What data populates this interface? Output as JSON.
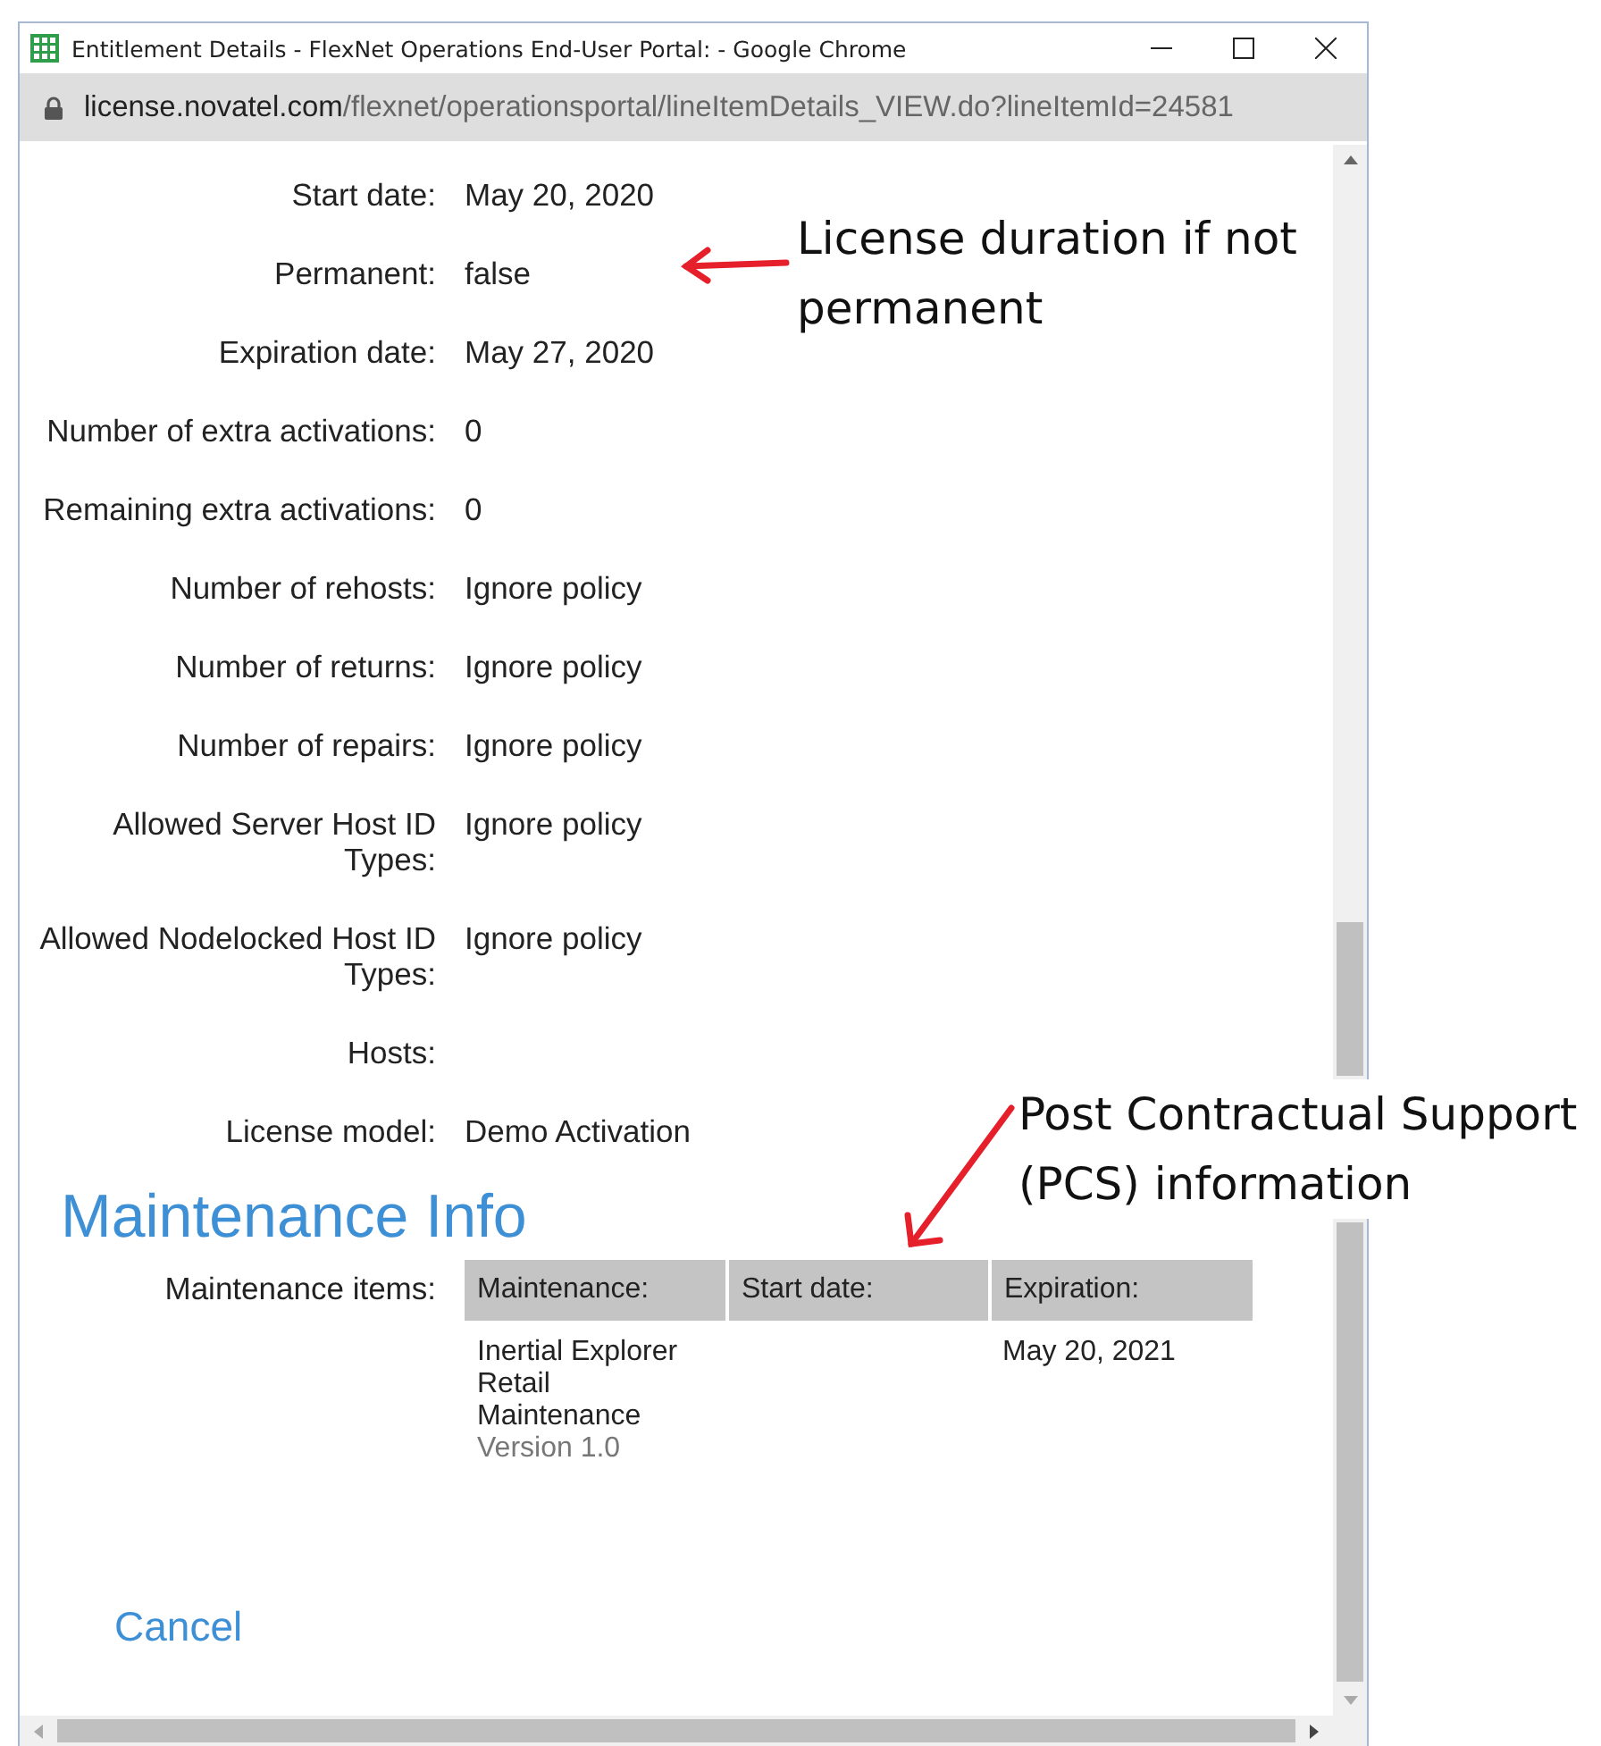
{
  "window": {
    "title": "Entitlement Details - FlexNet Operations End-User Portal: - Google Chrome",
    "url_host": "license.novatel.com",
    "url_path": "/flexnet/operationsportal/lineItemDetails_VIEW.do?lineItemId=24581"
  },
  "fields": [
    {
      "label": "Start date:",
      "value": "May 20, 2020"
    },
    {
      "label": "Permanent:",
      "value": "false"
    },
    {
      "label": "Expiration date:",
      "value": "May 27, 2020"
    },
    {
      "label": "Number of extra activations:",
      "value": "0"
    },
    {
      "label": "Remaining extra activations:",
      "value": "0"
    },
    {
      "label": "Number of rehosts:",
      "value": "Ignore policy"
    },
    {
      "label": "Number of returns:",
      "value": "Ignore policy"
    },
    {
      "label": "Number of repairs:",
      "value": "Ignore policy"
    },
    {
      "label": "Allowed Server Host ID Types:",
      "value": "Ignore policy"
    },
    {
      "label": "Allowed Nodelocked Host ID Types:",
      "value": "Ignore policy"
    },
    {
      "label": "Hosts:"
    },
    {
      "label": "License model:",
      "value": "Demo Activation"
    }
  ],
  "maintenance": {
    "heading": "Maintenance Info",
    "label": "Maintenance items:",
    "columns": [
      "Maintenance:",
      "Start date:",
      "Expiration:"
    ],
    "rows": [
      {
        "name": "Inertial Explorer Retail Maintenance",
        "version": "Version 1.0",
        "expiration": "May 20, 2021"
      }
    ]
  },
  "cancel": "Cancel",
  "annotations": [
    {
      "text": "License duration if not permanent"
    },
    {
      "text": "Post Contractual Support (PCS) information"
    }
  ]
}
